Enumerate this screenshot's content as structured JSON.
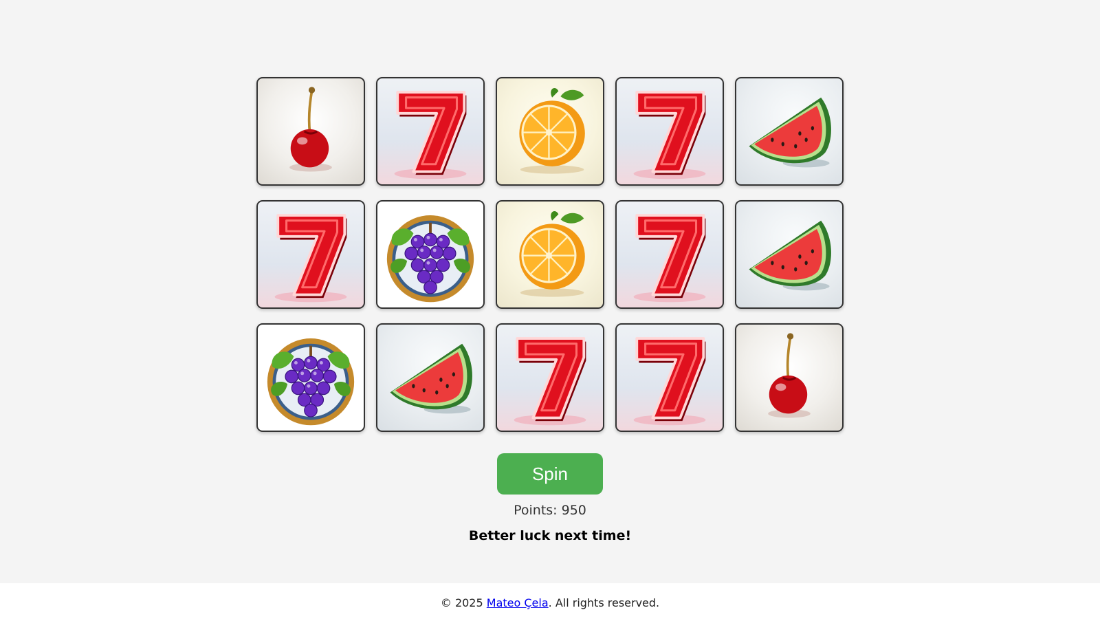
{
  "reels": [
    [
      "cherry",
      "seven",
      "orange",
      "seven",
      "watermelon"
    ],
    [
      "seven",
      "grapes",
      "orange",
      "seven",
      "watermelon"
    ],
    [
      "grapes",
      "watermelon",
      "seven",
      "seven",
      "cherry"
    ]
  ],
  "spin_button": {
    "label": "Spin"
  },
  "points": {
    "label": "Points:",
    "value": "950"
  },
  "message": "Better luck next time!",
  "footer": {
    "prefix": "© 2025",
    "author_link": "Mateo Çela",
    "suffix": ". All rights reserved."
  },
  "colors": {
    "spin_button": "#4caf50",
    "background": "#f4f4f4",
    "link": "#0000ee"
  }
}
